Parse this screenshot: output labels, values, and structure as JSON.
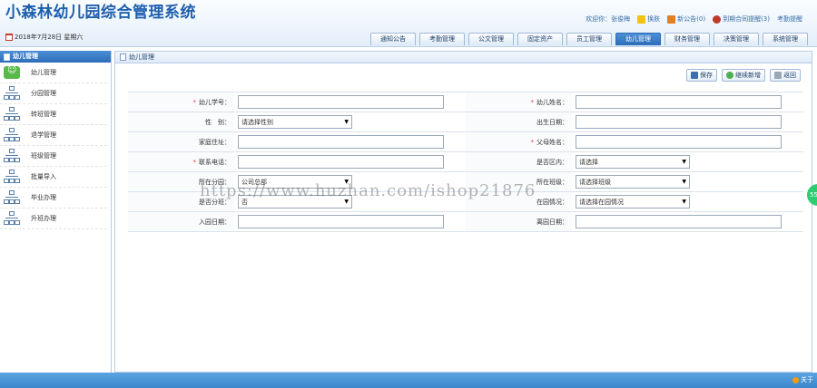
{
  "app_title": "小森林幼儿园综合管理系统",
  "top_links": {
    "welcome": "欢迎你：张俊梅",
    "switch": "换肤",
    "notice": "新公告(0)",
    "reminder": "到期合同提醒(3)",
    "attendance": "考勤提醒"
  },
  "date_text": "2018年7月28日 星期六",
  "tabs": [
    "通知公告",
    "考勤管理",
    "公文管理",
    "固定资产",
    "员工管理",
    "幼儿管理",
    "财务管理",
    "决策管理",
    "系统管理"
  ],
  "sidebar": {
    "title": "幼儿管理",
    "items": [
      "幼儿管理",
      "分园管理",
      "转班管理",
      "退学管理",
      "班级管理",
      "批量导入",
      "毕业办理",
      "升班办理"
    ]
  },
  "main": {
    "title": "幼儿管理",
    "buttons": {
      "save": "保存",
      "continue": "继续新增",
      "back": "返回"
    }
  },
  "form": {
    "student_no_label": "幼儿学号：",
    "name_label": "幼儿姓名：",
    "gender_label": "性　别：",
    "gender_value": "请选择性别",
    "birthdate_label": "出生日期：",
    "address_label": "家庭住址：",
    "parent_label": "父母姓名：",
    "phone_label": "联系电话：",
    "district_label": "是否区内：",
    "district_value": "请选择",
    "branch_label": "所在分园：",
    "branch_value": "公司总部",
    "class_label": "所在班级：",
    "class_value": "请选择班级",
    "transfer_label": "是否分班：",
    "transfer_value": "否",
    "status_label": "在园情况：",
    "status_value": "请选择在园情况",
    "enter_label": "入园日期：",
    "leave_label": "离园日期："
  },
  "footer": {
    "about": "关于"
  },
  "watermark": "https://www.huzhan.com/ishop21876",
  "float_badge": "55"
}
